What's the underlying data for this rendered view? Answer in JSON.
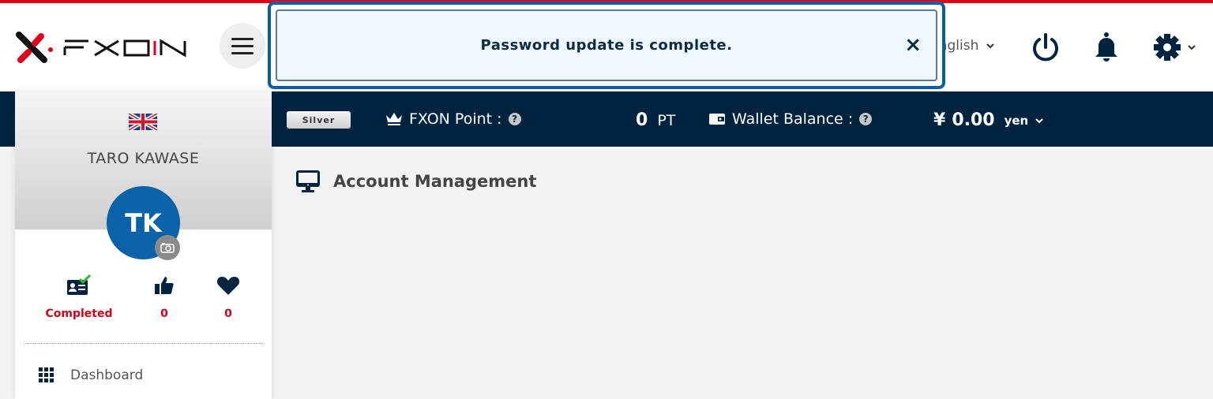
{
  "header": {
    "logo_text": "FXON",
    "menu_icon": "hamburger-icon",
    "language": "English",
    "icons": [
      "power-icon",
      "bell-icon",
      "gear-icon"
    ]
  },
  "toast": {
    "message": "Password update is complete.",
    "close_label": "×"
  },
  "statusbar": {
    "rank": "Silver",
    "points_label": "FXON Point :",
    "points_value": "0",
    "points_unit": "PT",
    "wallet_label": "Wallet Balance :",
    "wallet_currency": "¥",
    "wallet_value": "0.00",
    "wallet_unit": "yen",
    "help": "?"
  },
  "profile": {
    "name": "TARO KAWASE",
    "initials": "TK",
    "stats": [
      {
        "icon": "id-card-check-icon",
        "value": "Completed"
      },
      {
        "icon": "thumbs-up-icon",
        "value": "0"
      },
      {
        "icon": "heart-icon",
        "value": "0"
      }
    ]
  },
  "sidebar": {
    "items": [
      {
        "icon": "grid-icon",
        "label": "Dashboard"
      }
    ]
  },
  "main": {
    "title": "Account Management",
    "title_icon": "monitor-icon"
  },
  "colors": {
    "accent_red": "#e1001a",
    "navy": "#00243f",
    "toast_border": "#0a5fa3",
    "avatar_blue": "#0a63a8",
    "stat_red": "#d0021b"
  }
}
